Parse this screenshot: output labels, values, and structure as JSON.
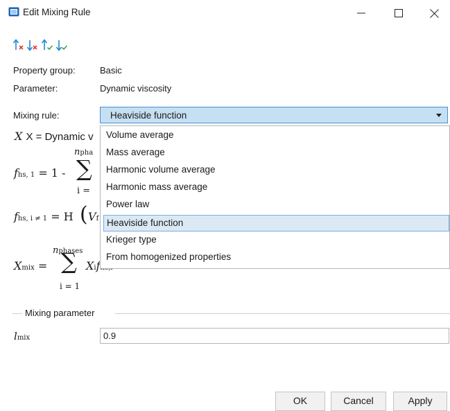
{
  "window": {
    "title": "Edit Mixing Rule"
  },
  "toolbar": {
    "icons": [
      "move-up-remove-icon",
      "move-down-remove-icon",
      "move-up-add-icon",
      "move-down-add-icon"
    ]
  },
  "fields": {
    "property_group_label": "Property group:",
    "property_group_value": "Basic",
    "parameter_label": "Parameter:",
    "parameter_value": "Dynamic viscosity",
    "mixing_rule_label": "Mixing rule:",
    "mixing_rule_value": "Heaviside function"
  },
  "dropdown": {
    "options": [
      "Volume average",
      "Mass average",
      "Harmonic volume average",
      "Harmonic mass average",
      "Power law",
      "Heaviside function",
      "Krieger type",
      "From homogenized properties"
    ],
    "selected_index": 5
  },
  "equations": {
    "x_def": "X = Dynamic v",
    "n_phases_partial": "n",
    "n_phases_partial_sub": "pha",
    "i_eq_partial": "i =",
    "fhs1_lhs": "f",
    "fhs1_sub": "hs, 1",
    "fhs1_rhs": "= 1 -",
    "sum_symbol": "∑",
    "fhsi_lhs": "f",
    "fhsi_sub": "hs, i ≠ 1",
    "fhsi_rhs": "= H",
    "fhsi_v": "V",
    "fhsi_v_sub": "f",
    "xmix_lhs": "X",
    "xmix_sub": "mix",
    "xmix_eq": "=",
    "xmix_upper": "n",
    "xmix_upper_sub": "phases",
    "xmix_lower": "i = 1",
    "xmix_term": "X",
    "xmix_term_sub": "i",
    "xmix_term_f": "f",
    "xmix_term_f_sub": "hs,i"
  },
  "mixing_parameter": {
    "group_title": "Mixing parameter",
    "lmix_label": "l",
    "lmix_sub": "mix",
    "lmix_value": "0.9"
  },
  "buttons": {
    "ok": "OK",
    "cancel": "Cancel",
    "apply": "Apply"
  },
  "colors": {
    "selection_bg": "#dbe9f5",
    "combo_bg": "#c5dff3",
    "accent": "#1e88d6",
    "remove": "#e53935",
    "add": "#43a047"
  }
}
